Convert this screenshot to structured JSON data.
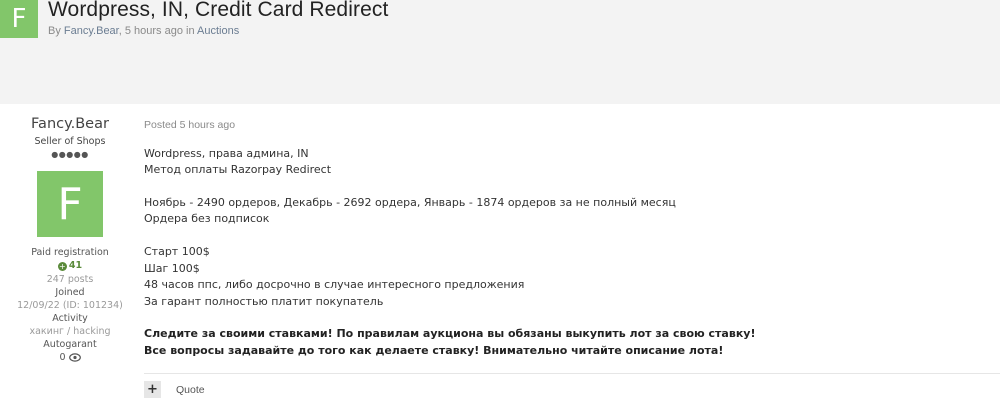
{
  "topic": {
    "avatar_letter": "F",
    "title": "Wordpress, IN, Credit Card Redirect",
    "meta_by": "By ",
    "meta_author": "Fancy.Bear",
    "meta_time": ", 5 hours ago in ",
    "meta_forum": "Auctions"
  },
  "author": {
    "name": "Fancy.Bear",
    "group": "Seller of Shops",
    "pips": "●●●●●",
    "avatar_letter": "F",
    "paid": "Paid registration",
    "reputation": "41",
    "posts": "247 posts",
    "joined_label": "Joined",
    "joined_value": "12/09/22 (ID: 101234)",
    "activity_label": "Activity",
    "activity_value": "хакинг / hacking",
    "autogarant_label": "Autogarant",
    "autogarant_value": "0"
  },
  "post": {
    "posted": "Posted 5 hours ago",
    "lines": [
      "Wordpress, права админа, IN",
      "Метод оплаты Razorpay Redirect",
      "Ноябрь - 2490 ордеров, Декабрь - 2692 ордера, Январь - 1874 ордеров за не полный месяц",
      "Ордера без подписок",
      "Старт 100$",
      "Шаг 100$",
      "48 часов ппс, либо досрочно в случае интересного предложения",
      "За гарант полностью платит покупатель",
      "Следите за своими ставками! По правилам аукциона вы обязаны выкупить лот за свою ставку!",
      "Все вопросы задавайте до того как делаете ставку! Внимательно читайте описание лота!"
    ],
    "quote_label": "Quote",
    "plus_label": "+"
  },
  "colors": {
    "avatar_bg": "#82c66a",
    "header_bg": "#f3f3f3",
    "reputation": "#5a8a3a"
  }
}
